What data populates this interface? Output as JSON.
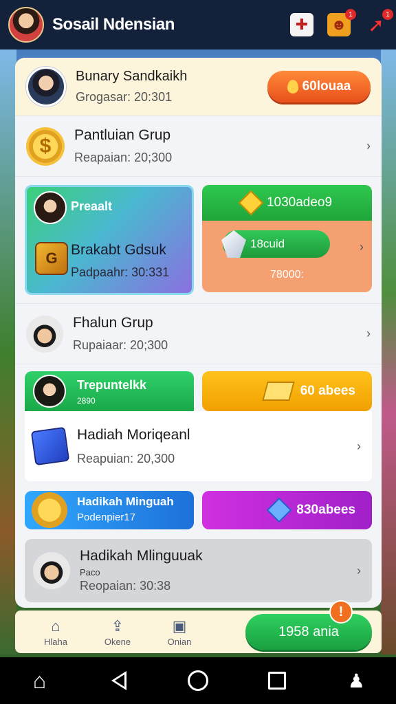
{
  "app": {
    "title": "Sosail Ndensian",
    "badge_gift": "1",
    "badge_arrow": "1"
  },
  "header": {
    "name": "Bunary Sandkaikh",
    "sub": "Grogasar: 20:301",
    "coin_label": "60louaa"
  },
  "rows": [
    {
      "title": "Pantluian Grup",
      "sub": "Reapaian: 20;300"
    }
  ],
  "split": {
    "card_a": {
      "label": "Preaalt",
      "title": "Brakabt Gdsuk",
      "sub": "Padpaahr: 30:331",
      "box_glyph": "G"
    },
    "card_b": {
      "top": "1030adeo9",
      "pill": "18cuid",
      "bottom": "78000:"
    }
  },
  "row2": {
    "title": "Fhalun Grup",
    "sub": "Rupaiaar: 20;300"
  },
  "banner1": {
    "green_l1": "Trepuntelkk",
    "green_l2": "2890",
    "yellow": "60 abees"
  },
  "white_row": {
    "title": "Hadiah Moriqeanl",
    "sub": "Reapuian: 20,300"
  },
  "banner2": {
    "blue_l1": "Hadikah Minguah",
    "blue_l2": "Podenpier17",
    "purple": "830abees"
  },
  "grey_row": {
    "title": "Hadikah Mlinguuak",
    "small": "Paco",
    "sub": "Reopaian: 30:38"
  },
  "tabs": [
    {
      "icon": "home-icon",
      "glyph": "⌂",
      "label": "Hlaha"
    },
    {
      "icon": "upload-icon",
      "glyph": "⇪",
      "label": "Okene"
    },
    {
      "icon": "briefcase-icon",
      "glyph": "▣",
      "label": "Onian"
    }
  ],
  "claim": {
    "label": "1958 ania",
    "alert": "!"
  },
  "nav": {
    "home": "⌂"
  }
}
